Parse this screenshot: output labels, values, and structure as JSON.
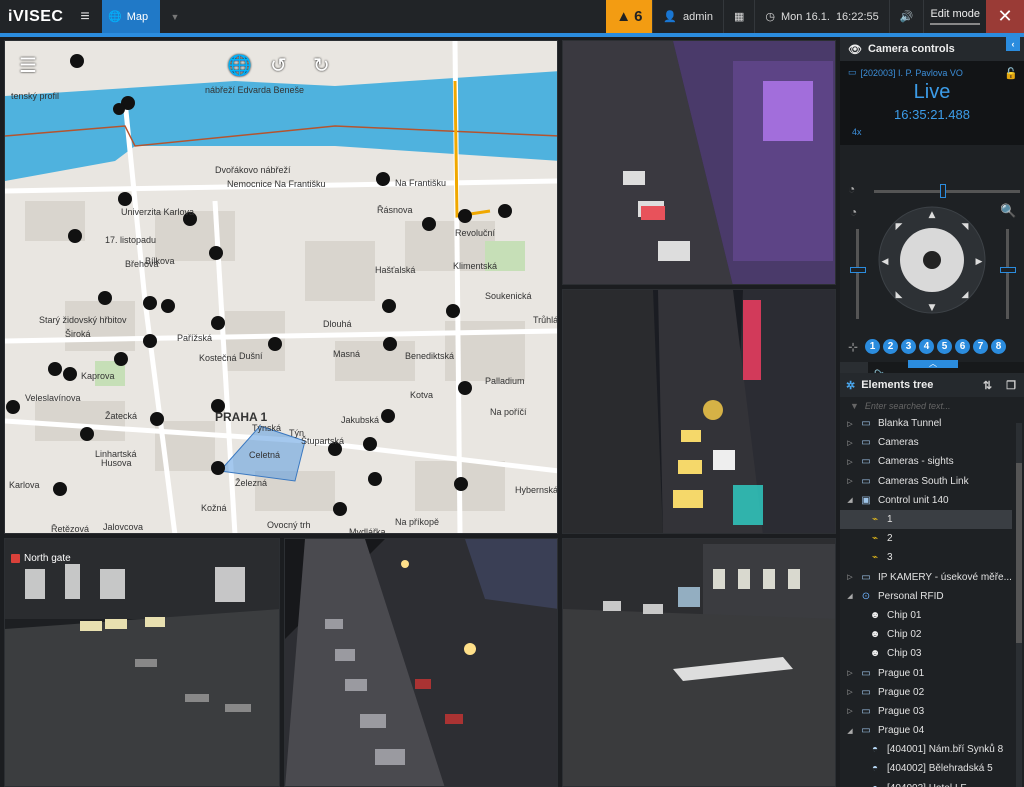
{
  "app": {
    "logo": "iVISEC",
    "tab_map": "Map"
  },
  "topbar": {
    "alarm_count": "6",
    "user": "admin",
    "date": "Mon 16.1.",
    "time": "16:22:55",
    "edit_mode": "Edit mode"
  },
  "colors": {
    "accent": "#2b8cde",
    "alarm": "#f39c12",
    "close": "#9a3b36",
    "map_river": "#4fb2de"
  },
  "map": {
    "labels": [
      "tenský profil",
      "nábřeží Edvarda Beneše",
      "Dvořákovo nábřeží",
      "Nemocnice Na Františku",
      "Univerzita Karlova",
      "17. listopadu",
      "Břehová",
      "Bílkova",
      "Na Františku",
      "Řásnova",
      "Revoluční",
      "Hašťalská",
      "Klimentská",
      "Soukenická",
      "Starý židovský hřbitov",
      "Široká",
      "Pařížská",
      "Kostečná",
      "Dušní",
      "Dlouhá",
      "Masná",
      "Benediktská",
      "Trůhlá",
      "Kaprova",
      "Veleslavínova",
      "Žatecká",
      "Linhartská",
      "Husova",
      "PRAHA 1",
      "Týnská",
      "Týn",
      "Jakubská",
      "Štupartská",
      "Celetná",
      "Kotva",
      "Palladium",
      "Na poříčí",
      "Hybernská",
      "Karlova",
      "Řetězová",
      "Jalovcova",
      "Železná",
      "Kožná",
      "Ovocný trh",
      "Na příkopě",
      "Mydlářka"
    ],
    "tools": [
      "layers-icon",
      "globe-icon",
      "rotate-left-icon",
      "rotate-right-icon"
    ]
  },
  "cameras": {
    "north_gate": "North gate"
  },
  "camera_controls": {
    "title": "Camera controls",
    "camera_name": "[202003] I. P. Pavlova VO",
    "status": "Live",
    "timestamp": "16:35:21.488",
    "zoom": "4x",
    "presets": [
      "1",
      "2",
      "3",
      "4",
      "5",
      "6",
      "7",
      "8"
    ]
  },
  "elements_tree": {
    "title": "Elements tree",
    "search_placeholder": "Enter searched text...",
    "items": [
      {
        "label": "Blanka Tunnel",
        "icon": "camera-group-icon",
        "expanded": false
      },
      {
        "label": "Cameras",
        "icon": "camera-group-icon",
        "expanded": false
      },
      {
        "label": "Cameras - sights",
        "icon": "camera-group-icon",
        "expanded": false
      },
      {
        "label": "Cameras South Link",
        "icon": "camera-group-icon",
        "expanded": false
      },
      {
        "label": "Control unit 140",
        "icon": "control-unit-icon",
        "expanded": true
      },
      {
        "label": "1",
        "icon": "sensor-icon",
        "child": true,
        "selected": true
      },
      {
        "label": "2",
        "icon": "sensor-icon",
        "child": true
      },
      {
        "label": "3",
        "icon": "sensor-icon",
        "child": true
      },
      {
        "label": "IP KAMERY -  úsekové měře...",
        "icon": "camera-group-icon",
        "expanded": false
      },
      {
        "label": "Personal RFID",
        "icon": "rfid-icon",
        "expanded": true
      },
      {
        "label": "Chip 01",
        "icon": "person-chip-icon",
        "child": true
      },
      {
        "label": "Chip 02",
        "icon": "person-chip-icon",
        "child": true
      },
      {
        "label": "Chip 03",
        "icon": "person-chip-icon",
        "child": true
      },
      {
        "label": "Prague 01",
        "icon": "camera-group-icon",
        "expanded": false
      },
      {
        "label": "Prague 02",
        "icon": "camera-group-icon",
        "expanded": false
      },
      {
        "label": "Prague 03",
        "icon": "camera-group-icon",
        "expanded": false
      },
      {
        "label": "Prague 04",
        "icon": "camera-group-icon",
        "expanded": true
      },
      {
        "label": "[404001] Nám.bří Synků 8",
        "icon": "dome-camera-icon",
        "child": true
      },
      {
        "label": "[404002] Bělehradská 5",
        "icon": "dome-camera-icon",
        "child": true
      },
      {
        "label": "[404003] Hotel I.F.",
        "icon": "dome-camera-icon",
        "child": true
      }
    ]
  }
}
